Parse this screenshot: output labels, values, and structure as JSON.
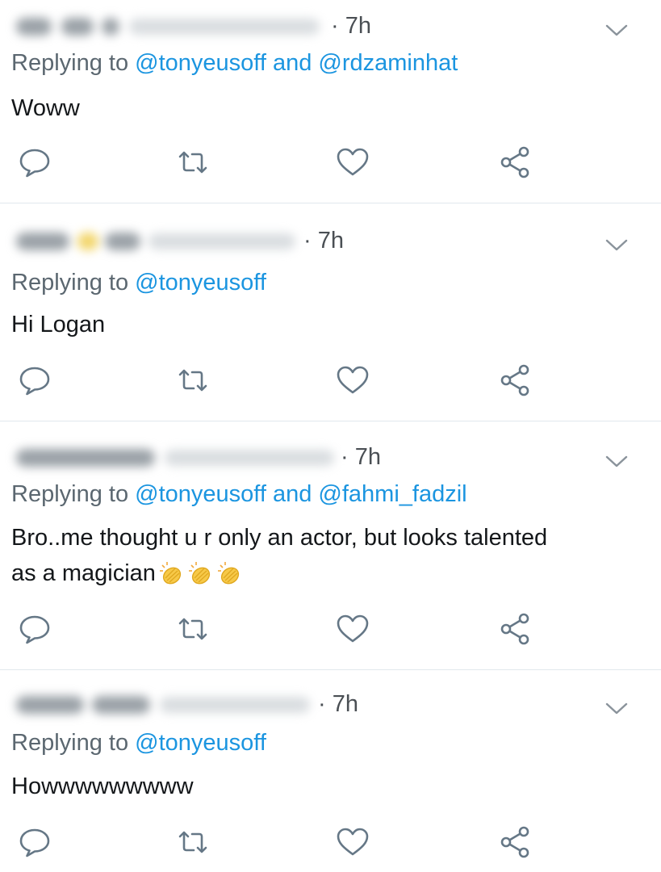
{
  "tweets": [
    {
      "time": "· 7h",
      "replying_prefix": "Replying to",
      "mentions": [
        "@tonyeusoff",
        "@rdzaminhat"
      ],
      "connector": "and",
      "text": "Woww",
      "text_line2": ""
    },
    {
      "time": "· 7h",
      "replying_prefix": "Replying to",
      "mentions": [
        "@tonyeusoff"
      ],
      "connector": "",
      "text": "Hi Logan",
      "text_line2": ""
    },
    {
      "time": "· 7h",
      "replying_prefix": "Replying to",
      "mentions": [
        "@tonyeusoff",
        "@fahmi_fadzil"
      ],
      "connector": "and",
      "text": "Bro..me thought u r only an actor, but looks talented",
      "text_line2": "as a magician"
    },
    {
      "time": "· 7h",
      "replying_prefix": "Replying to",
      "mentions": [
        "@tonyeusoff"
      ],
      "connector": "",
      "text": "Howwwwwwwww",
      "text_line2": ""
    }
  ],
  "icons": {
    "reply": "reply-icon",
    "retweet": "retweet-icon",
    "like": "heart-icon",
    "share": "share-icon",
    "menu": "chevron-down-icon",
    "clap": "clapping-hands-emoji"
  },
  "colors": {
    "mention": "#1b95e0",
    "secondary_text": "#5b6770",
    "icon": "#657786",
    "divider": "#e1e8ed"
  }
}
